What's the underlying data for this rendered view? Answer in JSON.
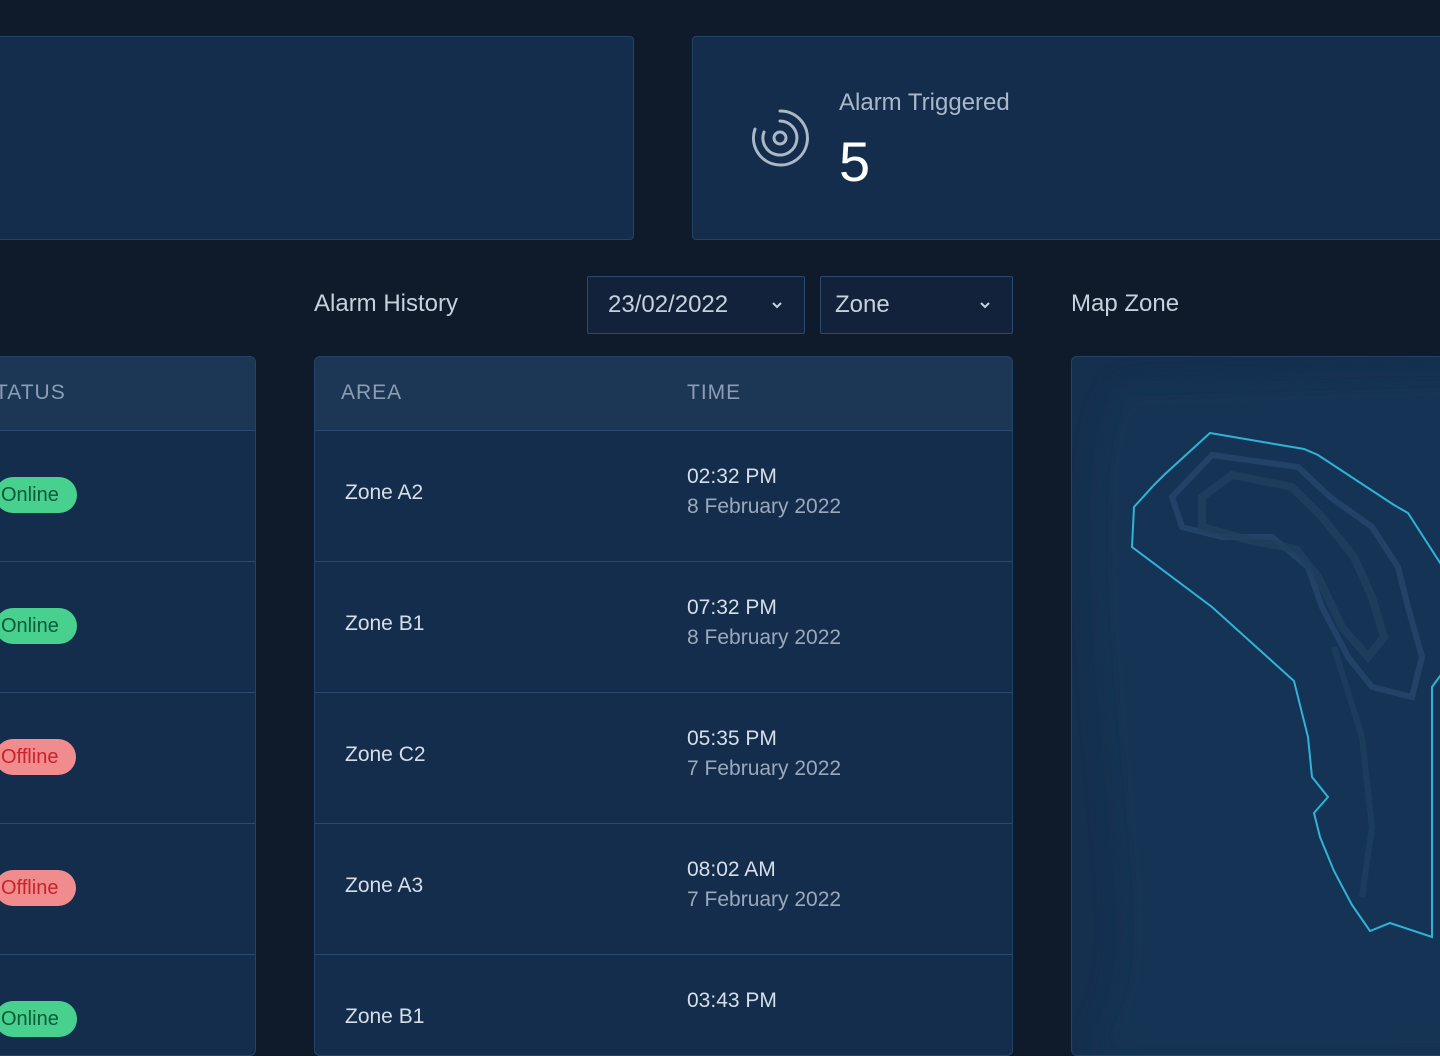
{
  "stats": {
    "alarm": {
      "label": "Alarm Triggered",
      "value": "5",
      "icon": "radar-icon"
    }
  },
  "history": {
    "title": "Alarm History",
    "date_filter": {
      "value": "23/02/2022",
      "icon": "chevron-down-icon"
    },
    "zone_filter": {
      "value": "Zone",
      "icon": "chevron-down-icon"
    },
    "columns": {
      "area": "AREA",
      "time": "TIME"
    },
    "rows": [
      {
        "area": "Zone A2",
        "time": "02:32 PM",
        "date": "8 February 2022"
      },
      {
        "area": "Zone B1",
        "time": "07:32 PM",
        "date": "8 February 2022"
      },
      {
        "area": "Zone C2",
        "time": "05:35 PM",
        "date": "7 February 2022"
      },
      {
        "area": "Zone A3",
        "time": "08:02 AM",
        "date": "7 February 2022"
      },
      {
        "area": "Zone B1",
        "time": "03:43 PM",
        "date": ""
      }
    ]
  },
  "status_table": {
    "column": "TATUS",
    "rows": [
      {
        "status": "Online",
        "state": "online"
      },
      {
        "status": "Online",
        "state": "online"
      },
      {
        "status": "Offline",
        "state": "offline"
      },
      {
        "status": "Offline",
        "state": "offline"
      },
      {
        "status": "Online",
        "state": "online"
      }
    ]
  },
  "map": {
    "title": "Map Zone"
  },
  "colors": {
    "background": "#0f1a2a",
    "card": "#142d4c",
    "online_bg": "#48d08f",
    "offline_bg": "#f08c8e",
    "map_outline": "#2fb3d6"
  }
}
